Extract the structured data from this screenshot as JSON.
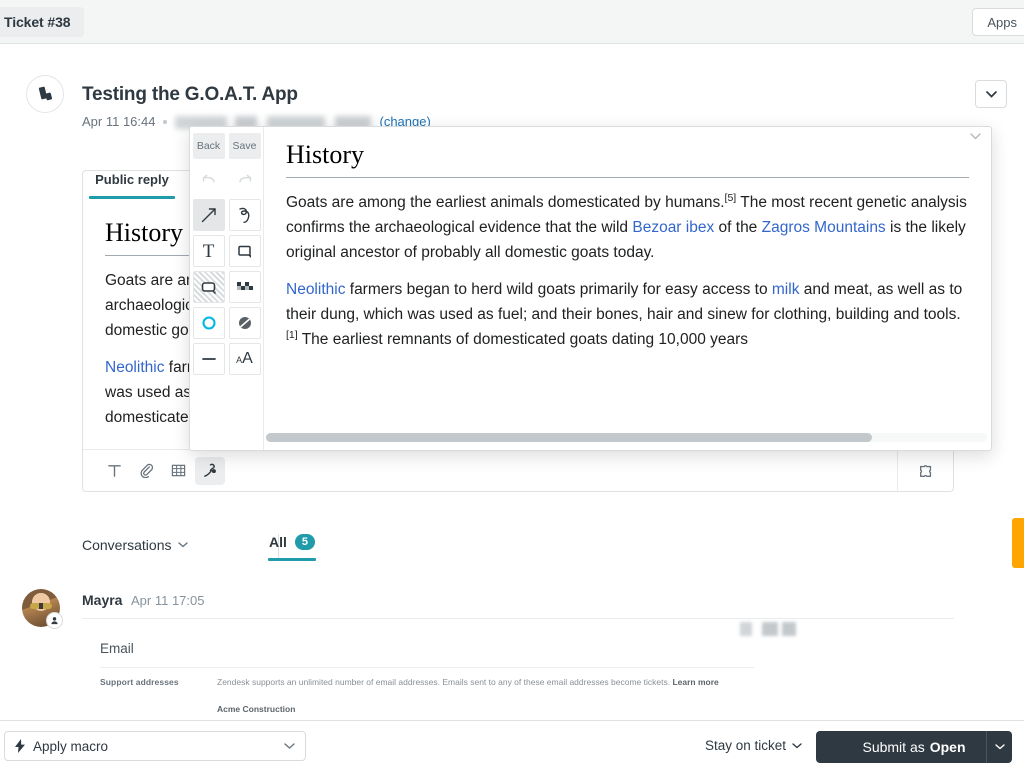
{
  "topbar": {
    "ticket_tab_label": "Ticket #38",
    "apps_label": "Apps"
  },
  "ticket": {
    "title": "Testing the G.O.A.T. App",
    "timestamp": "Apr 11 16:44",
    "requester_masked": "",
    "change_link": "(change)"
  },
  "composer": {
    "tab_label": "Public reply",
    "footer_icons": [
      "text-format-icon",
      "attachment-icon",
      "table-icon",
      "annotate-icon"
    ],
    "apps_icon": "puzzle-piece-icon"
  },
  "article": {
    "heading": "History",
    "paragraphs": [
      {
        "runs": [
          {
            "t": "Goats are among the earliest animals domesticated by humans.",
            "k": "text"
          },
          {
            "t": "[5]",
            "k": "ref"
          },
          {
            "t": " The most recent genetic analysis confirms the archaeological evidence that the wild ",
            "k": "text"
          },
          {
            "t": "Bezoar ibex",
            "k": "link"
          },
          {
            "t": " of the ",
            "k": "text"
          },
          {
            "t": "Zagros Mountains",
            "k": "link"
          },
          {
            "t": " is the likely original ancestor of probably all domestic goats today.",
            "k": "text"
          }
        ]
      },
      {
        "runs": [
          {
            "t": "Neolithic",
            "k": "link"
          },
          {
            "t": " farmers began to herd wild goats primarily for easy access to ",
            "k": "text"
          },
          {
            "t": "milk",
            "k": "link"
          },
          {
            "t": " and meat, as well as to their dung, which was used as fuel; and their bones, hair and sinew for clothing, building and tools.",
            "k": "text"
          },
          {
            "t": "[1]",
            "k": "ref"
          },
          {
            "t": " The earliest remnants of domesticated goats dating 10,000 years",
            "k": "text"
          }
        ]
      }
    ]
  },
  "annotation": {
    "back_label": "Back",
    "save_label": "Save",
    "tools": [
      {
        "name": "undo-icon",
        "selected": false
      },
      {
        "name": "redo-icon",
        "selected": false
      },
      {
        "name": "arrow-tool-icon",
        "selected": true
      },
      {
        "name": "freehand-tool-icon",
        "selected": false
      },
      {
        "name": "text-tool-icon",
        "selected": false
      },
      {
        "name": "rectangle-tool-icon",
        "selected": false
      },
      {
        "name": "highlight-tool-icon",
        "selected": false
      },
      {
        "name": "pixelate-tool-icon",
        "selected": false
      },
      {
        "name": "ellipse-tool-icon",
        "selected": false
      },
      {
        "name": "color-tool-icon",
        "selected": false
      },
      {
        "name": "line-width-tool-icon",
        "selected": false
      },
      {
        "name": "font-size-tool-icon",
        "selected": false
      }
    ]
  },
  "conversations": {
    "label": "Conversations",
    "tab_all_label": "All",
    "tab_all_count": "5"
  },
  "comment": {
    "author": "Mayra",
    "timestamp": "Apr 11 17:05",
    "attachment": {
      "section_title": "Email",
      "row_label": "Support addresses",
      "row_description": "Zendesk supports an unlimited number of email addresses. Emails sent to any of these email addresses become tickets.",
      "row_link": "Learn more",
      "row_value": "Acme Construction"
    }
  },
  "bottombar": {
    "macro_label": "Apply macro",
    "stay_label": "Stay on ticket",
    "submit_prefix": "Submit as",
    "submit_status": "Open"
  },
  "colors": {
    "accent_teal": "#1f9baa",
    "link_blue": "#1f73b7",
    "wiki_link": "#3366cc",
    "submit_dark": "#2f3941",
    "edge_tab_orange": "#ffa500"
  }
}
